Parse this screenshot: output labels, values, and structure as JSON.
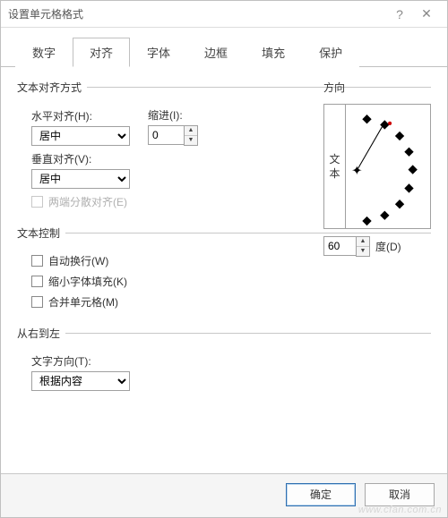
{
  "window": {
    "title": "设置单元格格式"
  },
  "tabs": {
    "items": [
      {
        "label": "数字"
      },
      {
        "label": "对齐"
      },
      {
        "label": "字体"
      },
      {
        "label": "边框"
      },
      {
        "label": "填充"
      },
      {
        "label": "保护"
      }
    ],
    "active_index": 1
  },
  "text_align": {
    "legend": "文本对齐方式",
    "h_label": "水平对齐(H):",
    "h_value": "居中",
    "indent_label": "缩进(I):",
    "indent_value": "0",
    "v_label": "垂直对齐(V):",
    "v_value": "居中",
    "justify_label": "两端分散对齐(E)"
  },
  "text_control": {
    "legend": "文本控制",
    "wrap_label": "自动换行(W)",
    "shrink_label": "缩小字体填充(K)",
    "merge_label": "合并单元格(M)"
  },
  "rtl": {
    "legend": "从右到左",
    "dir_label": "文字方向(T):",
    "dir_value": "根据内容"
  },
  "orientation": {
    "legend": "方向",
    "vtext_top": "文",
    "vtext_bottom": "本",
    "degrees_value": "60",
    "degrees_label": "度(D)"
  },
  "footer": {
    "ok": "确定",
    "cancel": "取消"
  },
  "watermark": "www.cfan.com.cn"
}
